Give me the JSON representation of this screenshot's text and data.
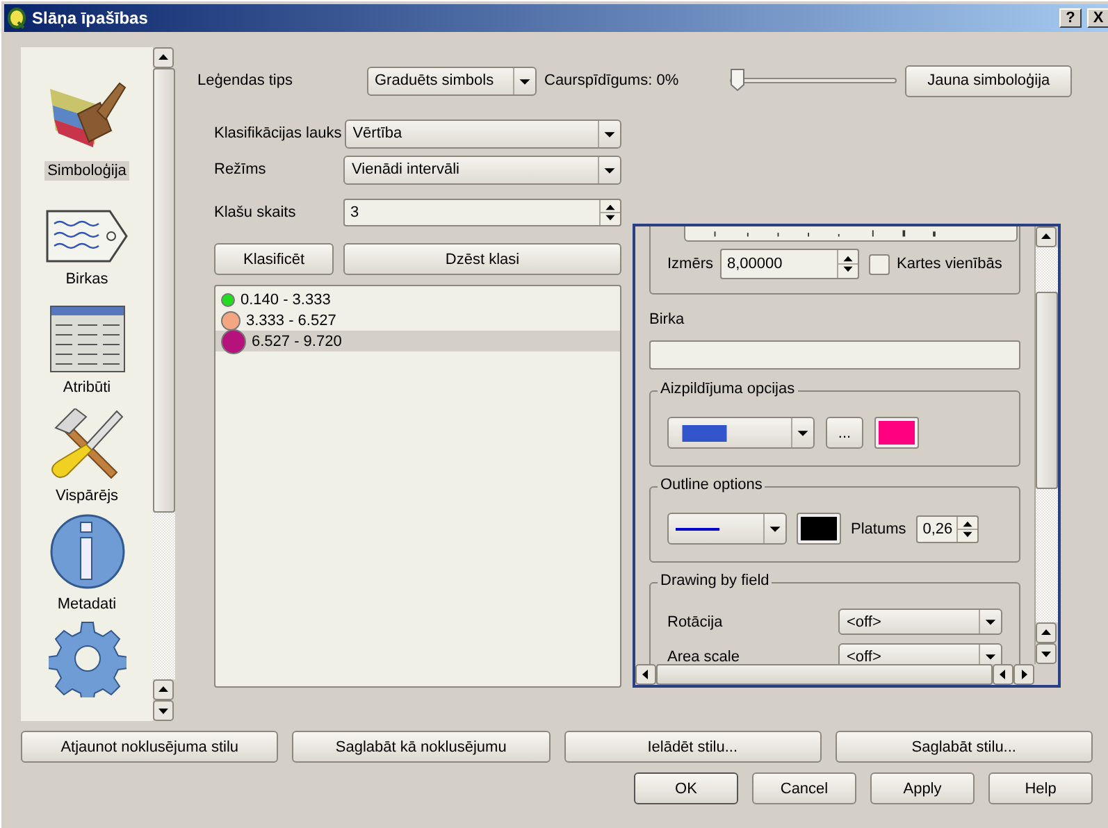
{
  "window": {
    "title": "Slāņa īpašības",
    "help_button": "?",
    "close_button": "X"
  },
  "sidebar": {
    "items": [
      {
        "label": "Simboloģija",
        "selected": true
      },
      {
        "label": "Birkas",
        "selected": false
      },
      {
        "label": "Atribūti",
        "selected": false
      },
      {
        "label": "Vispārējs",
        "selected": false
      },
      {
        "label": "Metadati",
        "selected": false
      },
      {
        "selected": false
      }
    ]
  },
  "symbology": {
    "legend_type": {
      "label": "Leģendas tips",
      "value": "Graduēts simbols"
    },
    "transparency": {
      "label": "Caurspīdīgums: 0%",
      "level": 0
    },
    "new_symbology_button": "Jauna simboloģija",
    "classification_field": {
      "label": "Klasifikācijas lauks",
      "value": "Vērtība"
    },
    "mode": {
      "label": "Režīms",
      "value": "Vienādi intervāli"
    },
    "class_count": {
      "label": "Klašu skaits",
      "value": "3"
    },
    "classify_button": "Klasificēt",
    "delete_class_button": "Dzēst klasi",
    "classes": [
      {
        "label": "0.140 - 3.333",
        "color": "#22dd22",
        "selected": false
      },
      {
        "label": "3.333 - 6.527",
        "color": "#f4a582",
        "selected": false
      },
      {
        "label": "6.527 - 9.720",
        "color": "#b5127c",
        "selected": true
      }
    ]
  },
  "symbol_editor": {
    "size": {
      "label": "Izmērs",
      "value": "8,00000"
    },
    "map_units": {
      "label": "Kartes vienībās",
      "checked": false
    },
    "label_field": {
      "label": "Birka"
    },
    "fill": {
      "title": "Aizpildījuma opcijas",
      "style": {
        "color": "#3355cc"
      },
      "more_button": "...",
      "color": "#ff0080"
    },
    "outline": {
      "title": "Outline options",
      "style": {
        "color": "#0000cc"
      },
      "color": "#000000",
      "width": {
        "label": "Platums",
        "value": "0,26"
      }
    },
    "drawing_by_field": {
      "title": "Drawing by field",
      "rows": [
        {
          "label": "Rotācija",
          "value": "<off>"
        },
        {
          "label": "Area scale",
          "value": "<off>"
        }
      ]
    }
  },
  "style_buttons": [
    "Atjaunot noklusējuma stilu",
    "Saglabāt kā noklusējumu",
    "Ielādēt stilu...",
    "Saglabāt stilu..."
  ],
  "dialog_buttons": [
    "OK",
    "Cancel",
    "Apply",
    "Help"
  ]
}
